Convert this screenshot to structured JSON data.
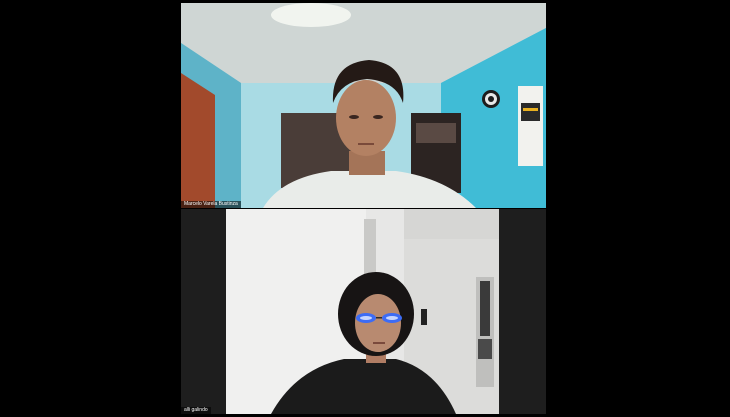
{
  "call": {
    "participants": [
      {
        "name": "Marcelo Varela Bustinza"
      },
      {
        "name": "alli galindo"
      }
    ]
  },
  "colors": {
    "background": "#000000",
    "wall_blue": "#7ec9d8",
    "name_tag_bg": "rgba(0,0,0,0.55)"
  }
}
